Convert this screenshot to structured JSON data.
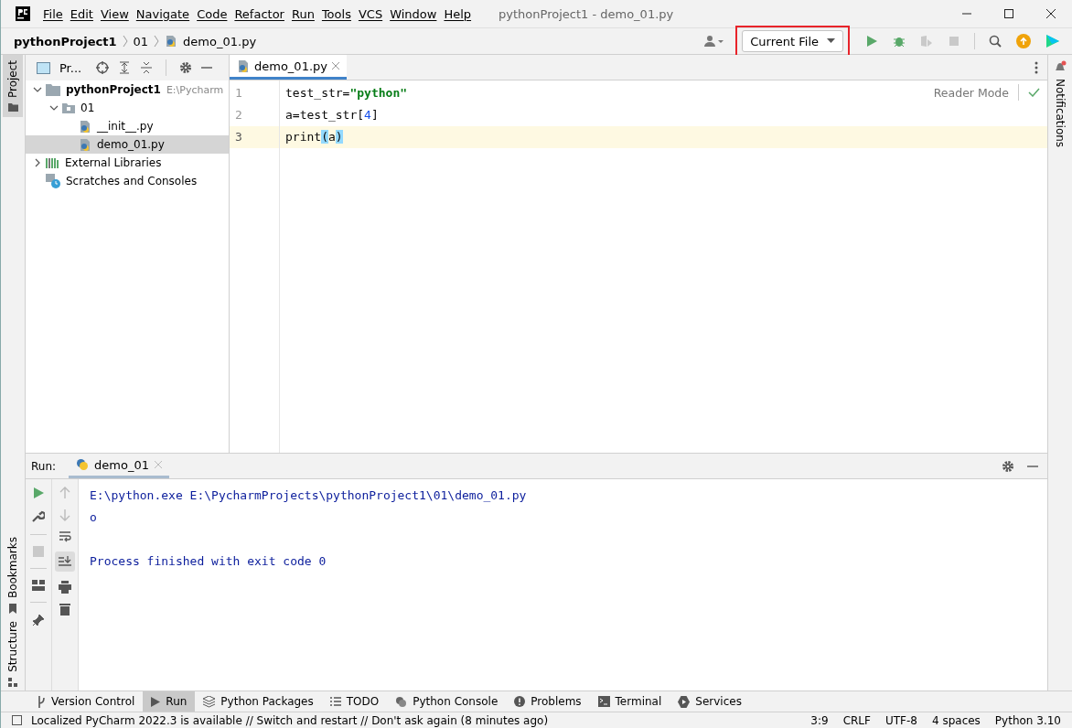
{
  "window": {
    "title": "pythonProject1 - demo_01.py"
  },
  "menu": [
    "File",
    "Edit",
    "View",
    "Navigate",
    "Code",
    "Refactor",
    "Run",
    "Tools",
    "VCS",
    "Window",
    "Help"
  ],
  "breadcrumbs": [
    {
      "label": "pythonProject1",
      "kind": "project"
    },
    {
      "label": "01",
      "kind": "folder"
    },
    {
      "label": "demo_01.py",
      "kind": "file"
    }
  ],
  "run_config": {
    "label": "Current File",
    "highlighted": true
  },
  "left_stripe": [
    {
      "label": "Project",
      "selected": true
    }
  ],
  "left_stripe_bottom": [
    {
      "label": "Bookmarks"
    },
    {
      "label": "Structure"
    }
  ],
  "right_stripe": [
    {
      "label": "Notifications",
      "badge": true
    }
  ],
  "project_panel": {
    "title": "Pr...",
    "tree": [
      {
        "label": "pythonProject1",
        "hint": "E:\\Pycharm",
        "kind": "project",
        "expanded": true,
        "selected": false,
        "children": [
          {
            "label": "01",
            "kind": "folder",
            "expanded": true,
            "selected": false,
            "children": [
              {
                "label": "__init__.py",
                "kind": "python",
                "selected": false
              },
              {
                "label": "demo_01.py",
                "kind": "python",
                "selected": true
              }
            ]
          }
        ]
      },
      {
        "label": "External Libraries",
        "kind": "libraries",
        "expanded": false,
        "selected": false
      },
      {
        "label": "Scratches and Consoles",
        "kind": "scratches",
        "selected": false
      }
    ]
  },
  "editor": {
    "tabs": [
      {
        "label": "demo_01.py",
        "selected": true
      }
    ],
    "reader_mode": "Reader Mode",
    "lines": [
      {
        "number": "1",
        "current": false,
        "tokens": [
          {
            "text": "test_str=",
            "kind": "plain"
          },
          {
            "text": "\"python\"",
            "kind": "string"
          }
        ]
      },
      {
        "number": "2",
        "current": false,
        "tokens": [
          {
            "text": "a=test_str[",
            "kind": "plain"
          },
          {
            "text": "4",
            "kind": "number"
          },
          {
            "text": "]",
            "kind": "plain"
          }
        ]
      },
      {
        "number": "3",
        "current": true,
        "tokens": [
          {
            "text": "print",
            "kind": "plain"
          },
          {
            "text": "(",
            "kind": "brace"
          },
          {
            "text": "a",
            "kind": "plain"
          },
          {
            "text": ")",
            "kind": "brace"
          }
        ]
      }
    ]
  },
  "run_panel": {
    "label": "Run:",
    "tabs": [
      {
        "label": "demo_01",
        "selected": true
      }
    ],
    "console": [
      {
        "text": "E:\\python.exe E:\\PycharmProjects\\pythonProject1\\01\\demo_01.py",
        "kind": "line"
      },
      {
        "text": "o",
        "kind": "line"
      },
      {
        "text": "Process finished with exit code 0",
        "kind": "after_gap"
      }
    ]
  },
  "tool_tabs": [
    {
      "label": "Version Control",
      "kind": "branch",
      "selected": false
    },
    {
      "label": "Run",
      "kind": "play",
      "selected": true
    },
    {
      "label": "Python Packages",
      "kind": "layers",
      "selected": false
    },
    {
      "label": "TODO",
      "kind": "list",
      "selected": false
    },
    {
      "label": "Python Console",
      "kind": "python",
      "selected": false
    },
    {
      "label": "Problems",
      "kind": "alert",
      "selected": false
    },
    {
      "label": "Terminal",
      "kind": "terminal",
      "selected": false
    },
    {
      "label": "Services",
      "kind": "services",
      "selected": false
    }
  ],
  "status_bar": {
    "message": "Localized PyCharm 2022.3 is available // Switch and restart // Don't ask again (8 minutes ago)",
    "items": [
      "3:9",
      "CRLF",
      "UTF-8",
      "4 spaces",
      "Python 3.10"
    ]
  }
}
